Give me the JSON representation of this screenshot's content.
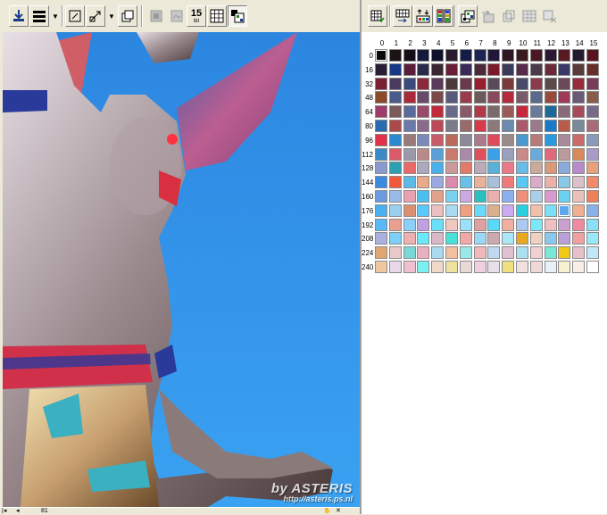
{
  "left_toolbar": {
    "buttons": [
      {
        "name": "download-icon",
        "glyph": "⭳"
      },
      {
        "name": "stack-view-icon",
        "glyph": "☰"
      },
      {
        "name": "dropdown-arrow-icon",
        "glyph": "▼"
      },
      {
        "name": "crop-icon",
        "glyph": "⬚"
      },
      {
        "name": "transform-icon",
        "glyph": "⇱"
      },
      {
        "name": "dropdown-arrow-icon",
        "glyph": "▼"
      },
      {
        "name": "copy-window-icon",
        "glyph": "⧉"
      },
      {
        "name": "image-ops-icon",
        "glyph": "▣"
      },
      {
        "name": "image-filter-icon",
        "glyph": "▤"
      },
      {
        "name": "bit-depth-label",
        "glyph": "15"
      },
      {
        "name": "grid-icon",
        "glyph": "▦"
      },
      {
        "name": "palette-view-icon",
        "glyph": "▩"
      }
    ],
    "bit_depth_number": "15",
    "bit_depth_unit": "bit"
  },
  "right_toolbar": {
    "buttons": [
      {
        "name": "palette-apply-icon",
        "glyph": "▦"
      },
      {
        "name": "palette-convert-icon",
        "glyph": "⇶"
      },
      {
        "name": "palette-sort-icon",
        "glyph": "⇅"
      },
      {
        "name": "palette-random-icon",
        "glyph": "▥"
      },
      {
        "name": "palette-layers-icon",
        "glyph": "▩"
      },
      {
        "name": "palette-undo-icon",
        "glyph": "⟲"
      },
      {
        "name": "palette-merge-icon",
        "glyph": "⧉"
      },
      {
        "name": "palette-grid-icon",
        "glyph": "▤"
      },
      {
        "name": "palette-clear-icon",
        "glyph": "▧"
      }
    ]
  },
  "canvas": {
    "watermark_main": "by ASTERIS",
    "watermark_url": "http://asteris.ps.nl"
  },
  "palette": {
    "columns": [
      "0",
      "1",
      "2",
      "3",
      "4",
      "5",
      "6",
      "7",
      "8",
      "9",
      "10",
      "11",
      "12",
      "13",
      "14",
      "15"
    ],
    "rows": [
      "0",
      "16",
      "32",
      "48",
      "64",
      "80",
      "96",
      "112",
      "128",
      "144",
      "160",
      "176",
      "192",
      "208",
      "224",
      "240"
    ],
    "selected_black": {
      "row": 0,
      "col": 0
    },
    "selected_white": {
      "row": 11,
      "col": 13
    },
    "colors": [
      [
        "#0a0a0a",
        "#1a1412",
        "#140e16",
        "#141a3c",
        "#10122a",
        "#2a1a2e",
        "#141c48",
        "#1c2454",
        "#22163a",
        "#2e1624",
        "#3a1a1e",
        "#4a1822",
        "#2c1a34",
        "#5a1a24",
        "#221c2e",
        "#5a1420"
      ],
      [
        "#2a1e34",
        "#163a86",
        "#5a1e3a",
        "#2a2a4a",
        "#3a2630",
        "#6a1e36",
        "#3a2a5a",
        "#4a2a3a",
        "#7a1a2a",
        "#3a3a5a",
        "#5a2a4a",
        "#4a3a4a",
        "#6a2a3a",
        "#3a3a6a",
        "#5a3a3a",
        "#6a2e2a"
      ],
      [
        "#7a1e34",
        "#4a3a5e",
        "#3a4a7a",
        "#8a2a3a",
        "#5a3a5a",
        "#4a3a3a",
        "#6a3a4a",
        "#9a1e2e",
        "#5a4a5a",
        "#7a3a3a",
        "#4a4a6a",
        "#8a3a4a",
        "#5a4a4a",
        "#6a4a5a",
        "#9a2a3a",
        "#7a3a5a"
      ],
      [
        "#8a4a2a",
        "#4a5a8a",
        "#aa2a3a",
        "#6a4a6a",
        "#7a4a4a",
        "#5a5a7a",
        "#9a3a4a",
        "#6a5a5a",
        "#8a4a5a",
        "#b42a3c",
        "#7a5a6a",
        "#5a6a8a",
        "#9a4a3a",
        "#a03a5a",
        "#6a5a7a",
        "#8a5a4a"
      ],
      [
        "#a03a6a",
        "#7a5a5a",
        "#5a6a9a",
        "#9a4a6a",
        "#c02a3a",
        "#6a6a8a",
        "#8a5a6a",
        "#b03a4a",
        "#7a6a6a",
        "#9a5a5a",
        "#c8283a",
        "#6a7a9a",
        "#1a6a9a",
        "#8a6a7a",
        "#a84a5a",
        "#7a6a8a"
      ],
      [
        "#2a6ab0",
        "#aa4a4a",
        "#6a7aaa",
        "#8a6a8a",
        "#ba4a5a",
        "#7a7a8a",
        "#9a6a6a",
        "#d83a4a",
        "#8a7a7a",
        "#6a8ab0",
        "#aa5a6a",
        "#9a7a8a",
        "#1a7aca",
        "#ba5a4a",
        "#7a8a9a",
        "#aa6a7a"
      ],
      [
        "#e0304a",
        "#2a8ad0",
        "#9a7a7a",
        "#7a8aba",
        "#c85a6a",
        "#ba6a5a",
        "#8a8a9a",
        "#aa7a8a",
        "#e04a5a",
        "#9a8a8a",
        "#4a9ad0",
        "#ba7a7a",
        "#2a9ae0",
        "#a88a9a",
        "#ca6a6a",
        "#8a9aba"
      ],
      [
        "#3a8ac8",
        "#da5a6a",
        "#9a9aaa",
        "#ba8a8a",
        "#5aa0d8",
        "#ca7a6a",
        "#aa8aaa",
        "#e0505a",
        "#3aa0e8",
        "#9aa0ba",
        "#ca8a8a",
        "#6aaadc",
        "#e06a7a",
        "#ba9a9a",
        "#da8a5a",
        "#aa9aca"
      ],
      [
        "#8a9ad0",
        "#2aa0b0",
        "#ea6a6a",
        "#aaaabc",
        "#4ab0e8",
        "#ca9a9a",
        "#e07a6a",
        "#baaaba",
        "#5ab0d8",
        "#ea7a8a",
        "#6abce8",
        "#caaa9a",
        "#da9a7a",
        "#8aaada",
        "#ba8aca",
        "#eaa07a"
      ],
      [
        "#3a8ae0",
        "#f05a3a",
        "#5abae8",
        "#eaaa8a",
        "#9aaae0",
        "#da8aaa",
        "#6ac0e8",
        "#eab09a",
        "#aac0da",
        "#f07a7a",
        "#5ac8f0",
        "#daaaca",
        "#eab0aa",
        "#8ac8e8",
        "#dac0ca",
        "#f08a6a"
      ],
      [
        "#6a9ae0",
        "#9abaea",
        "#eaa0b0",
        "#4ac0f0",
        "#e0a08a",
        "#7ad0f0",
        "#caaae0",
        "#2ac0c0",
        "#eab0b0",
        "#8ab0f0",
        "#f0907a",
        "#aad0e8",
        "#da9ad0",
        "#6ad0f0",
        "#eac0ba",
        "#f0805a"
      ],
      [
        "#4ab0f0",
        "#9ad0f0",
        "#da9070",
        "#5ac8f8",
        "#eac0c0",
        "#aadaf0",
        "#f0a080",
        "#6ad8f8",
        "#dab090",
        "#caaaf0",
        "#2ad0e0",
        "#f0c0aa",
        "#7ae0f8",
        "#5aa8f0",
        "#f0b090",
        "#8ab0e8"
      ],
      [
        "#5ab8f8",
        "#eaa090",
        "#8ad0f8",
        "#c0a0e0",
        "#6ae0f8",
        "#f0c8c0",
        "#9ae0f8",
        "#e0a0a0",
        "#5ad8f8",
        "#f0b0a0",
        "#aac8f0",
        "#7ae8f8",
        "#f0c0c0",
        "#caa0d0",
        "#f08aa0",
        "#8ae0f8"
      ],
      [
        "#aab0e0",
        "#7ad0f8",
        "#f0b0b0",
        "#6ae8f8",
        "#dab8c8",
        "#4ae0d8",
        "#f0a8a8",
        "#9ad8f8",
        "#caaab0",
        "#aae8f8",
        "#e8a820",
        "#f0d0c0",
        "#8ac8f0",
        "#baa0d8",
        "#f0a0a0",
        "#9ae8f8"
      ],
      [
        "#e0a870",
        "#e8c8c8",
        "#7ad8d8",
        "#e8b0c0",
        "#aadaf0",
        "#f0c0a0",
        "#9ae8e8",
        "#f0b8b8",
        "#c0d8f0",
        "#e0c0d0",
        "#aae0f0",
        "#f0d0d0",
        "#7ae8d8",
        "#f0c818",
        "#e8c0c8",
        "#c0e8f8"
      ],
      [
        "#f0c8a0",
        "#e8d8e8",
        "#f0c0d0",
        "#7af0f0",
        "#f0d8c8",
        "#f0e0a0",
        "#e8d8d8",
        "#f0d0e0",
        "#e8e0e8",
        "#f0e080",
        "#f0e0e0",
        "#f0d8d8",
        "#e8f0f8",
        "#f8f0d0",
        "#f8f0e8",
        "#ffffff"
      ]
    ]
  },
  "status_bar": {
    "page_label": "81"
  }
}
